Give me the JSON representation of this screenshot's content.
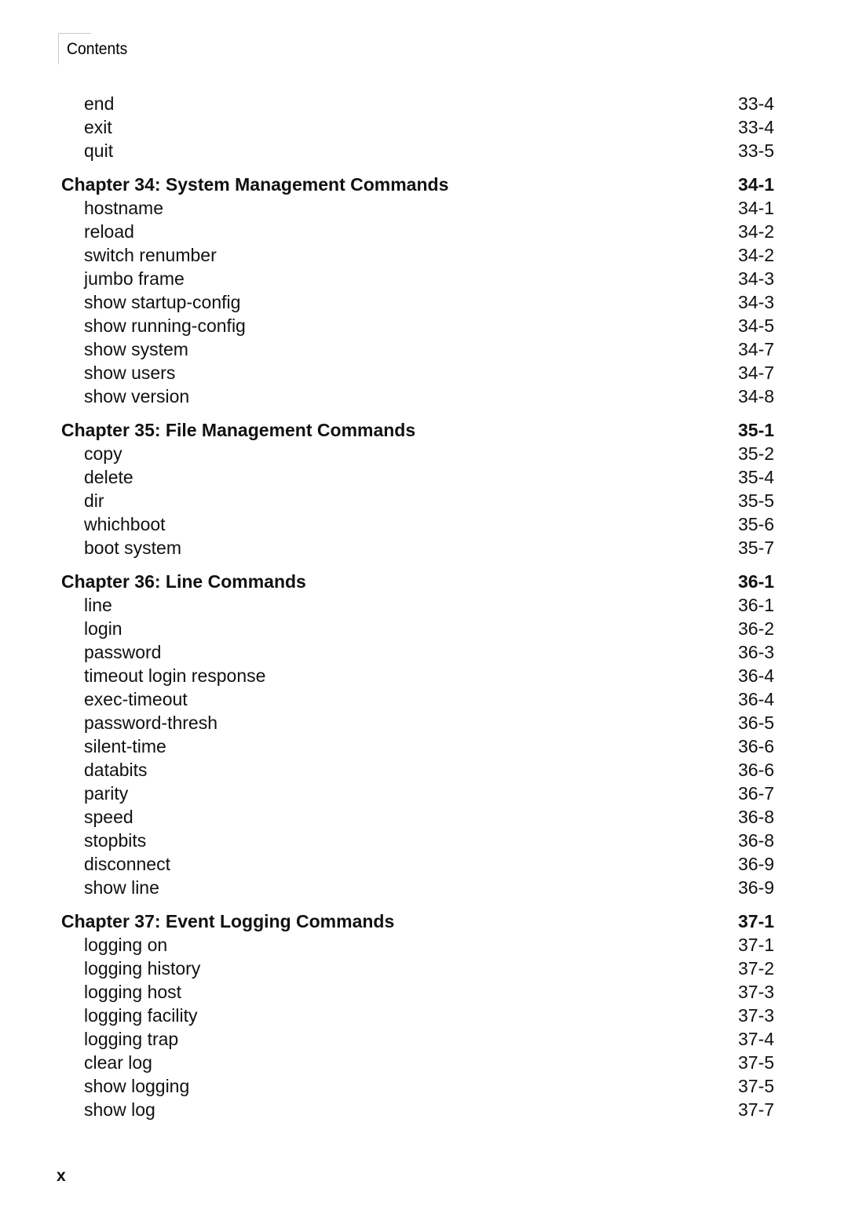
{
  "header": {
    "section_label": "Contents"
  },
  "toc": [
    {
      "type": "entry",
      "label": "end",
      "page": "33-4"
    },
    {
      "type": "entry",
      "label": "exit",
      "page": "33-4"
    },
    {
      "type": "entry",
      "label": "quit",
      "page": "33-5"
    },
    {
      "type": "chapter",
      "label": "Chapter 34: System Management Commands",
      "page": "34-1"
    },
    {
      "type": "entry",
      "label": "hostname",
      "page": "34-1"
    },
    {
      "type": "entry",
      "label": "reload",
      "page": "34-2"
    },
    {
      "type": "entry",
      "label": "switch renumber",
      "page": "34-2"
    },
    {
      "type": "entry",
      "label": "jumbo frame",
      "page": "34-3"
    },
    {
      "type": "entry",
      "label": "show startup-config",
      "page": "34-3"
    },
    {
      "type": "entry",
      "label": "show running-config",
      "page": "34-5"
    },
    {
      "type": "entry",
      "label": "show system",
      "page": "34-7"
    },
    {
      "type": "entry",
      "label": "show users",
      "page": "34-7"
    },
    {
      "type": "entry",
      "label": "show version",
      "page": "34-8"
    },
    {
      "type": "chapter",
      "label": "Chapter 35: File Management Commands",
      "page": "35-1"
    },
    {
      "type": "entry",
      "label": "copy",
      "page": "35-2"
    },
    {
      "type": "entry",
      "label": "delete",
      "page": "35-4"
    },
    {
      "type": "entry",
      "label": "dir",
      "page": "35-5"
    },
    {
      "type": "entry",
      "label": "whichboot",
      "page": "35-6"
    },
    {
      "type": "entry",
      "label": "boot system",
      "page": "35-7"
    },
    {
      "type": "chapter",
      "label": "Chapter 36: Line Commands",
      "page": "36-1"
    },
    {
      "type": "entry",
      "label": "line",
      "page": "36-1"
    },
    {
      "type": "entry",
      "label": "login",
      "page": "36-2"
    },
    {
      "type": "entry",
      "label": "password",
      "page": "36-3"
    },
    {
      "type": "entry",
      "label": "timeout login response",
      "page": "36-4"
    },
    {
      "type": "entry",
      "label": "exec-timeout",
      "page": "36-4"
    },
    {
      "type": "entry",
      "label": "password-thresh",
      "page": "36-5"
    },
    {
      "type": "entry",
      "label": "silent-time",
      "page": "36-6"
    },
    {
      "type": "entry",
      "label": "databits",
      "page": "36-6"
    },
    {
      "type": "entry",
      "label": "parity",
      "page": "36-7"
    },
    {
      "type": "entry",
      "label": "speed",
      "page": "36-8"
    },
    {
      "type": "entry",
      "label": "stopbits",
      "page": "36-8"
    },
    {
      "type": "entry",
      "label": "disconnect",
      "page": "36-9"
    },
    {
      "type": "entry",
      "label": "show line",
      "page": "36-9"
    },
    {
      "type": "chapter",
      "label": "Chapter 37: Event Logging Commands",
      "page": "37-1"
    },
    {
      "type": "entry",
      "label": "logging on",
      "page": "37-1"
    },
    {
      "type": "entry",
      "label": "logging history",
      "page": "37-2"
    },
    {
      "type": "entry",
      "label": "logging host",
      "page": "37-3"
    },
    {
      "type": "entry",
      "label": "logging facility",
      "page": "37-3"
    },
    {
      "type": "entry",
      "label": "logging trap",
      "page": "37-4"
    },
    {
      "type": "entry",
      "label": "clear log",
      "page": "37-5"
    },
    {
      "type": "entry",
      "label": "show logging",
      "page": "37-5"
    },
    {
      "type": "entry",
      "label": "show log",
      "page": "37-7"
    }
  ],
  "footer": {
    "page_number": "x"
  }
}
